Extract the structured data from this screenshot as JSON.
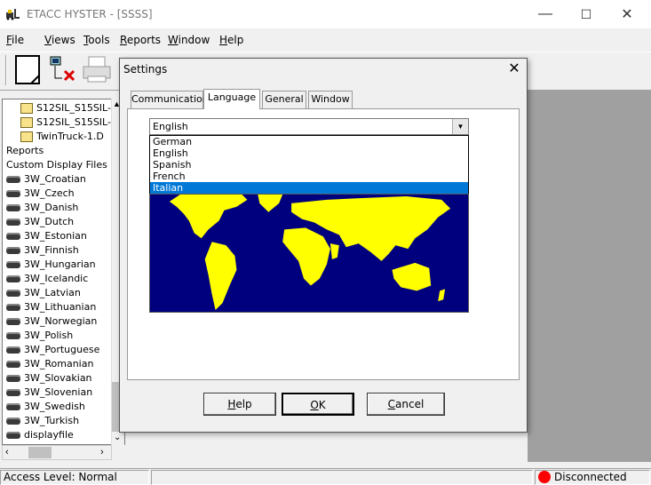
{
  "window": {
    "title": "ETACC HYSTER - [SSSS]",
    "minimize": "—",
    "maximize": "☐",
    "close": "✕"
  },
  "menu": [
    {
      "label": "File",
      "key": "F",
      "rest": "ile"
    },
    {
      "label": "Views",
      "key": "V",
      "rest": "iews"
    },
    {
      "label": "Tools",
      "key": "T",
      "rest": "ools"
    },
    {
      "label": "Reports",
      "key": "R",
      "rest": "eports"
    },
    {
      "label": "Window",
      "key": "W",
      "rest": "indow"
    },
    {
      "label": "Help",
      "key": "H",
      "rest": "elp"
    }
  ],
  "tree": {
    "items": [
      {
        "label": "S12SIL_S15SIL-",
        "icon": "folder-icon"
      },
      {
        "label": "S12SIL_S15SIL-",
        "icon": "folder-icon"
      },
      {
        "label": "TwinTruck-1.D",
        "icon": "folder-icon"
      },
      {
        "label": "Reports",
        "icon": ""
      },
      {
        "label": "Custom Display Files",
        "icon": ""
      },
      {
        "label": "3W_Croatian",
        "icon": "disk-icon"
      },
      {
        "label": "3W_Czech",
        "icon": "disk-icon"
      },
      {
        "label": "3W_Danish",
        "icon": "disk-icon"
      },
      {
        "label": "3W_Dutch",
        "icon": "disk-icon"
      },
      {
        "label": "3W_Estonian",
        "icon": "disk-icon"
      },
      {
        "label": "3W_Finnish",
        "icon": "disk-icon"
      },
      {
        "label": "3W_Hungarian",
        "icon": "disk-icon"
      },
      {
        "label": "3W_Icelandic",
        "icon": "disk-icon"
      },
      {
        "label": "3W_Latvian",
        "icon": "disk-icon"
      },
      {
        "label": "3W_Lithuanian",
        "icon": "disk-icon"
      },
      {
        "label": "3W_Norwegian",
        "icon": "disk-icon"
      },
      {
        "label": "3W_Polish",
        "icon": "disk-icon"
      },
      {
        "label": "3W_Portuguese",
        "icon": "disk-icon"
      },
      {
        "label": "3W_Romanian",
        "icon": "disk-icon"
      },
      {
        "label": "3W_Slovakian",
        "icon": "disk-icon"
      },
      {
        "label": "3W_Slovenian",
        "icon": "disk-icon"
      },
      {
        "label": "3W_Swedish",
        "icon": "disk-icon"
      },
      {
        "label": "3W_Turkish",
        "icon": "disk-icon"
      },
      {
        "label": "displayfile",
        "icon": "disk-icon"
      }
    ]
  },
  "status": {
    "access": "Access Level: Normal",
    "connection": "Disconnected",
    "connection_color": "#ff0000"
  },
  "dialog": {
    "title": "Settings",
    "close": "✕",
    "tabs": [
      {
        "label": "Communication",
        "active": false
      },
      {
        "label": "Language",
        "active": true
      },
      {
        "label": "General",
        "active": false
      },
      {
        "label": "Window",
        "active": false
      }
    ],
    "language_select": {
      "value": "English",
      "options": [
        "German",
        "English",
        "Spanish",
        "French",
        "Italian"
      ],
      "highlighted": "Italian"
    },
    "map_colors": {
      "ocean": "#00007f",
      "land": "#ffff00"
    },
    "buttons": {
      "help": {
        "key": "H",
        "rest": "elp"
      },
      "ok": {
        "key": "O",
        "rest": "K"
      },
      "cancel": {
        "key": "C",
        "rest": "ancel"
      }
    }
  }
}
